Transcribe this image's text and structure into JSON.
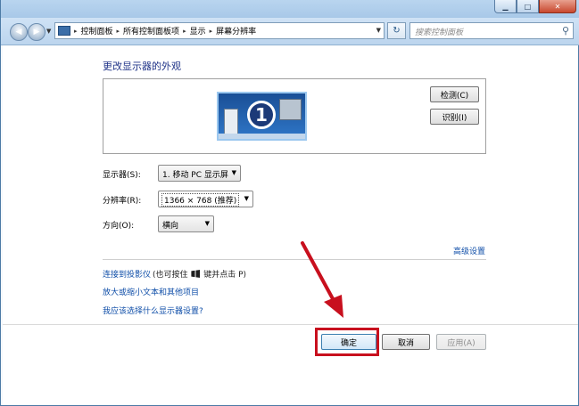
{
  "window": {
    "minimize_icon": "minimize-icon",
    "maximize_icon": "maximize-icon",
    "close_icon": "close-icon"
  },
  "navigation": {
    "back_glyph": "◀",
    "forward_glyph": "▶",
    "breadcrumbs": [
      "控制面板",
      "所有控制面板项",
      "显示",
      "屏幕分辨率"
    ],
    "separator": "▸",
    "refresh_glyph": "↻",
    "search_placeholder": "搜索控制面板"
  },
  "page": {
    "heading": "更改显示器的外观",
    "monitor_number": "1",
    "detect_button": "检测(C)",
    "identify_button": "识别(I)"
  },
  "settings": {
    "display_label": "显示器(S):",
    "display_value": "1. 移动 PC 显示屏",
    "resolution_label": "分辨率(R):",
    "resolution_value": "1366 × 768 (推荐)",
    "orientation_label": "方向(O):",
    "orientation_value": "横向"
  },
  "links": {
    "advanced": "高级设置",
    "projector": "连接到投影仪",
    "projector_note_before": "(也可按住",
    "projector_note_after": "键并点击 P)",
    "text_size": "放大或缩小文本和其他项目",
    "which_settings": "我应该选择什么显示器设置?"
  },
  "footer": {
    "ok": "确定",
    "cancel": "取消",
    "apply": "应用(A)"
  },
  "annotation": {
    "highlight_color": "#c8101e"
  }
}
